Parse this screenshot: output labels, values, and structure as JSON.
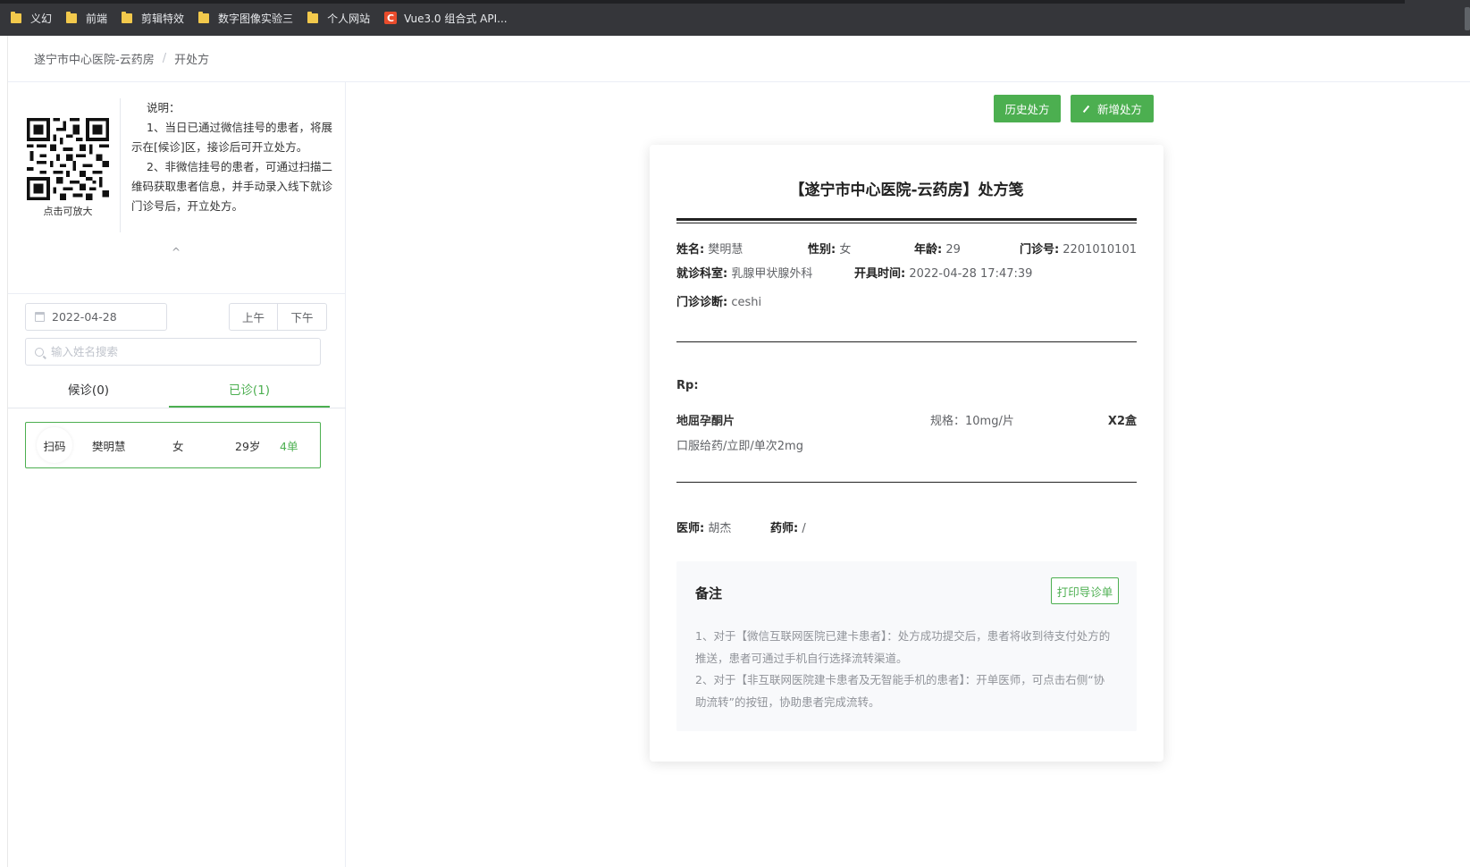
{
  "bookmarks": [
    {
      "label": "义幻",
      "icon": "folder-icon"
    },
    {
      "label": "前端",
      "icon": "folder-icon"
    },
    {
      "label": "剪辑特效",
      "icon": "folder-icon"
    },
    {
      "label": "数字图像实验三",
      "icon": "folder-icon"
    },
    {
      "label": "个人网站",
      "icon": "folder-icon"
    },
    {
      "label": "Vue3.0 组合式 API...",
      "icon": "csdn-icon",
      "icon_glyph": "C"
    }
  ],
  "breadcrumb": {
    "root": "遂宁市中心医院-云药房",
    "separator": "/",
    "current": "开处方"
  },
  "sidebar": {
    "qr_caption": "点击可放大",
    "notes": {
      "title": "说明：",
      "item1": "1、当日已通过微信挂号的患者，将展示在[候诊]区，接诊后可开立处方。",
      "item2": "2、非微信挂号的患者，可通过扫描二维码获取患者信息，并手动录入线下就诊门诊号后，开立处方。"
    },
    "collapse_glyph": "^",
    "date_value": "2022-04-28",
    "am_label": "上午",
    "pm_label": "下午",
    "search_placeholder": "输入姓名搜索",
    "tabs": [
      {
        "label": "候诊(0)",
        "active": false
      },
      {
        "label": "已诊(1)",
        "active": true
      }
    ],
    "patients": [
      {
        "scan_label": "扫码",
        "name": "樊明慧",
        "sex": "女",
        "age": "29岁",
        "count": "4单"
      }
    ]
  },
  "toolbar": {
    "history_label": "历史处方",
    "new_label": "新增处方"
  },
  "prescription": {
    "title": "【遂宁市中心医院-云药房】处方笺",
    "name_label": "姓名:",
    "name": "樊明慧",
    "sex_label": "性别:",
    "sex": "女",
    "age_label": "年龄:",
    "age": "29",
    "outpatient_no_label": "门诊号:",
    "outpatient_no": "2201010101",
    "dept_label": "就诊科室:",
    "dept": "乳腺甲状腺外科",
    "time_label": "开具时间:",
    "time": "2022-04-28 17:47:39",
    "diagnosis_label": "门诊诊断:",
    "diagnosis": "ceshi",
    "rp_label": "Rp:",
    "drug": {
      "name": "地屈孕酮片",
      "spec": "规格：10mg/片",
      "qty": "X2盒",
      "usage": "口服给药/立即/单次2mg"
    },
    "doctor_label": "医师:",
    "doctor": "胡杰",
    "pharmacist_label": "药师:",
    "pharmacist": "/",
    "remark": {
      "title": "备注",
      "print_label": "打印导诊单",
      "line1": "1、对于【微信互联网医院已建卡患者】：处方成功提交后，患者将收到待支付处方的推送，患者可通过手机自行选择流转渠道。",
      "line2": "2、对于【非互联网医院建卡患者及无智能手机的患者】：开单医师，可点击右侧“协助流转”的按钮，协助患者完成流转。"
    }
  },
  "colors": {
    "accent": "#4caf50",
    "bookmark_bar": "#35363a",
    "border": "#dcdfe6"
  }
}
